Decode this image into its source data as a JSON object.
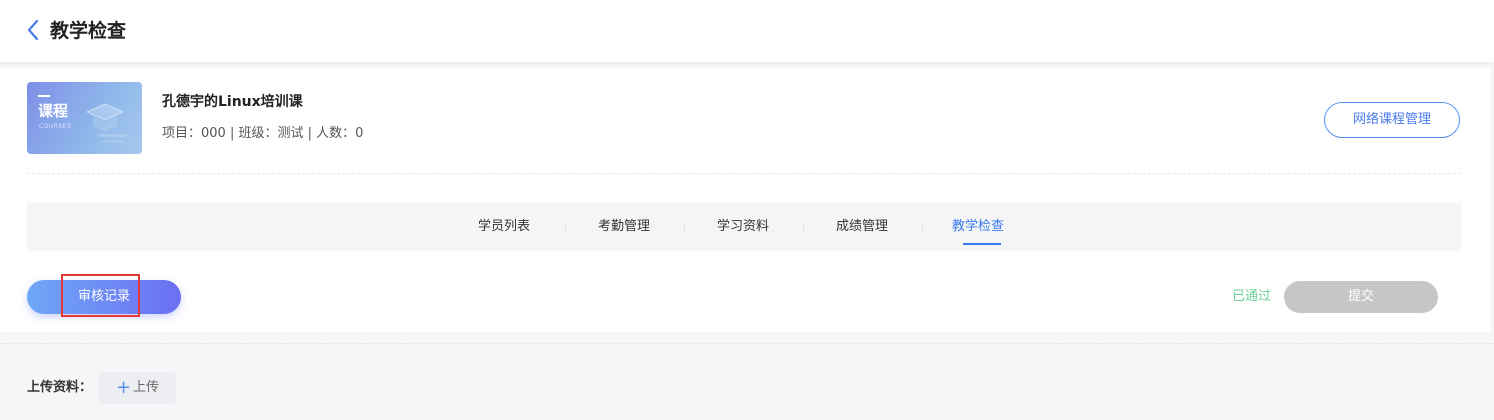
{
  "header": {
    "title": "教学检查"
  },
  "course": {
    "thumb_title": "课程",
    "thumb_subtitle": "COURSES",
    "title": "孔德宇的Linux培训课",
    "meta": "项目：000 | 班级：测试 | 人数：0",
    "manage_label": "网络课程管理"
  },
  "tabs": [
    {
      "label": "学员列表"
    },
    {
      "label": "考勤管理"
    },
    {
      "label": "学习资料"
    },
    {
      "label": "成绩管理"
    },
    {
      "label": "教学检查"
    }
  ],
  "actions": {
    "audit_label": "审核记录",
    "status_label": "已通过",
    "submit_label": "提交"
  },
  "upload": {
    "label": "上传资料：",
    "button_label": "上传"
  },
  "colors": {
    "accent": "#3a7cf0",
    "passed": "#6fcf97",
    "highlight": "#e53935",
    "disabled": "#c6c6c6"
  }
}
